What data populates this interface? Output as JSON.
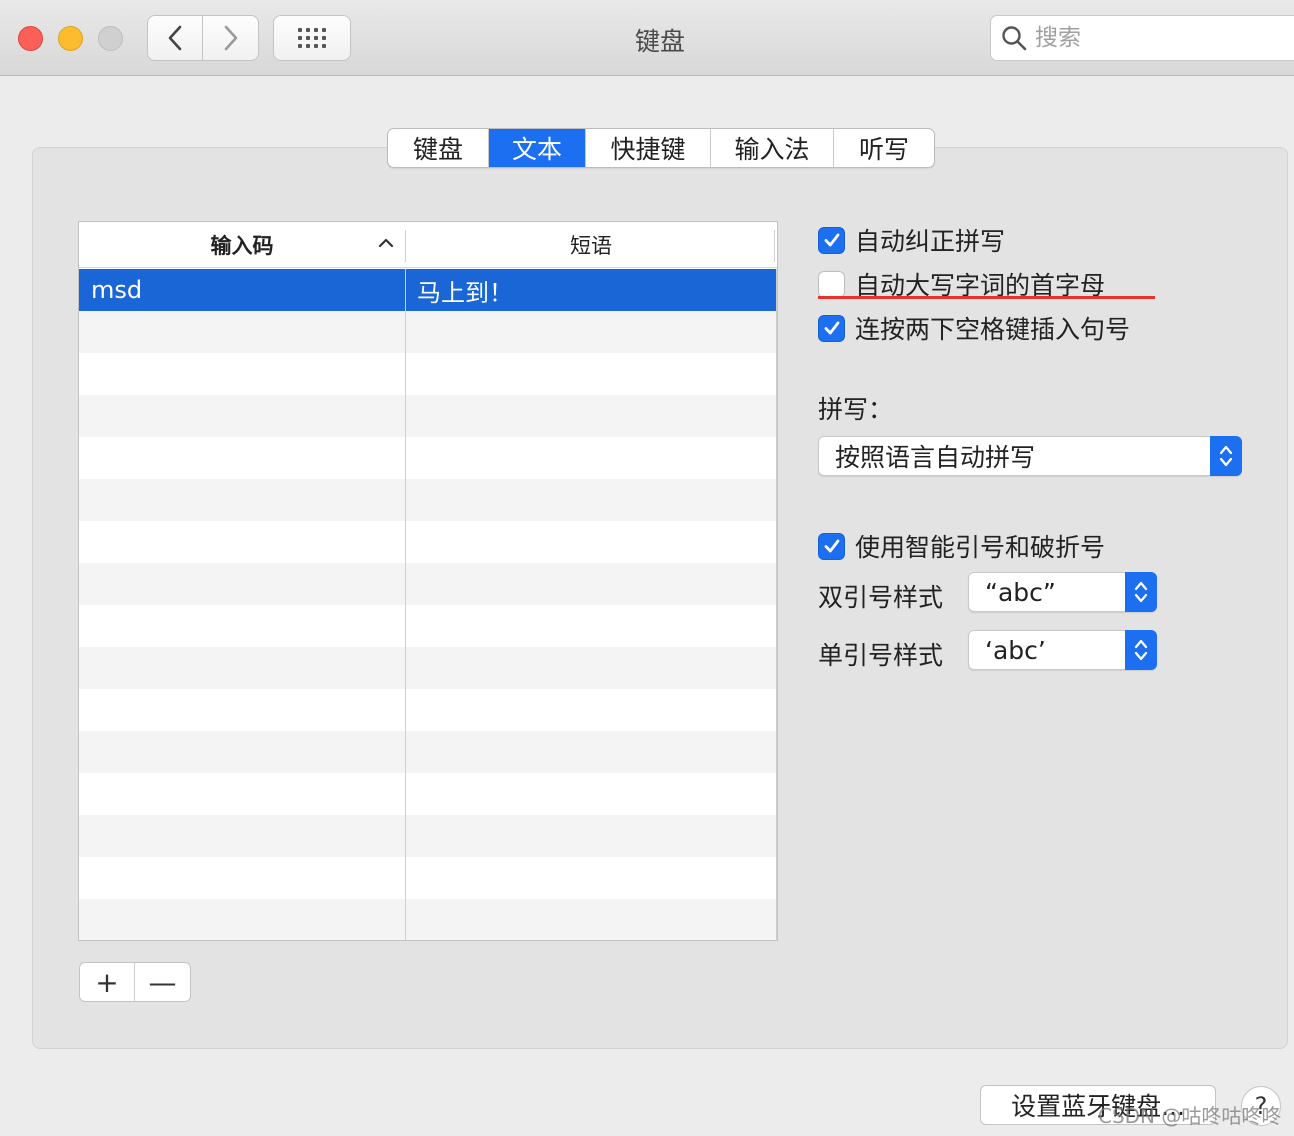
{
  "window": {
    "title": "键盘"
  },
  "search": {
    "placeholder": "搜索"
  },
  "tabs": [
    {
      "label": "键盘",
      "active": false
    },
    {
      "label": "文本",
      "active": true
    },
    {
      "label": "快捷键",
      "active": false
    },
    {
      "label": "输入法",
      "active": false
    },
    {
      "label": "听写",
      "active": false
    }
  ],
  "table": {
    "columns": [
      "输入码",
      "短语"
    ],
    "rows": [
      {
        "code": "msd",
        "phrase": "马上到！",
        "selected": true
      }
    ]
  },
  "options": {
    "auto_correct": {
      "label": "自动纠正拼写",
      "checked": true
    },
    "auto_capitalize": {
      "label": "自动大写字词的首字母",
      "checked": false
    },
    "double_space_period": {
      "label": "连按两下空格键插入句号",
      "checked": true
    },
    "spelling_label": "拼写：",
    "spelling_value": "按照语言自动拼写",
    "smart_quotes": {
      "label": "使用智能引号和破折号",
      "checked": true
    },
    "double_quote_label": "双引号样式",
    "double_quote_value": "“abc”",
    "single_quote_label": "单引号样式",
    "single_quote_value": "‘abc’"
  },
  "buttons": {
    "add": "+",
    "remove": "—",
    "bluetooth": "设置蓝牙键盘...",
    "help": "?"
  },
  "watermark": "CSDN @咕咚咕咚咚",
  "colors": {
    "accent": "#1b6ff0",
    "selection": "#1a66d6",
    "annotation": "#e8322c"
  }
}
